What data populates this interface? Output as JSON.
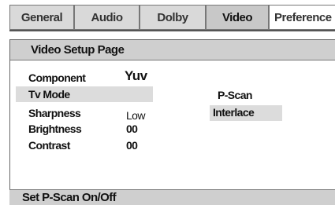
{
  "tabs": [
    {
      "label": "General"
    },
    {
      "label": "Audio"
    },
    {
      "label": "Dolby"
    },
    {
      "label": "Video"
    },
    {
      "label": "Preference"
    }
  ],
  "panel": {
    "title": "Video Setup Page",
    "rows": [
      {
        "label": "Component",
        "value": "Yuv"
      },
      {
        "label": "Tv Mode",
        "value": ""
      },
      {
        "label": "Sharpness",
        "value": "Low"
      },
      {
        "label": "Brightness",
        "value": "00"
      },
      {
        "label": "Contrast",
        "value": "00"
      }
    ],
    "options": [
      {
        "label": "P-Scan"
      },
      {
        "label": "Interlace"
      }
    ]
  },
  "status": {
    "text": "Set P-Scan On/Off"
  }
}
